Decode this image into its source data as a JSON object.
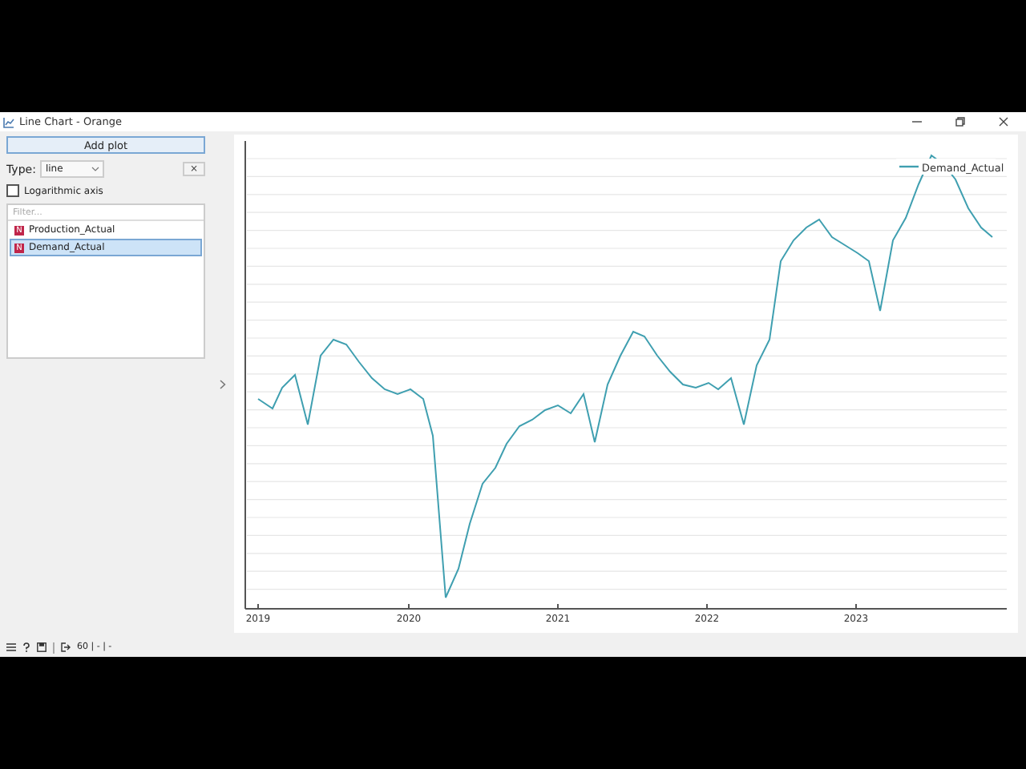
{
  "window": {
    "title": "Line Chart - Orange"
  },
  "controls": {
    "add_plot": "Add plot",
    "type_label": "Type:",
    "type_value": "line",
    "remove": "×",
    "log_axis": {
      "label": "Logarithmic axis",
      "checked": false
    },
    "filter_placeholder": "Filter...",
    "variables": [
      {
        "badge": "N",
        "name": "Production_Actual",
        "selected": false
      },
      {
        "badge": "N",
        "name": "Demand_Actual",
        "selected": true
      }
    ]
  },
  "chart": {
    "legend": "Demand_Actual",
    "x_labels": [
      "2019",
      "2020",
      "2021",
      "2022",
      "2023"
    ]
  },
  "status_bar": {
    "text": "60 | - | -"
  }
}
